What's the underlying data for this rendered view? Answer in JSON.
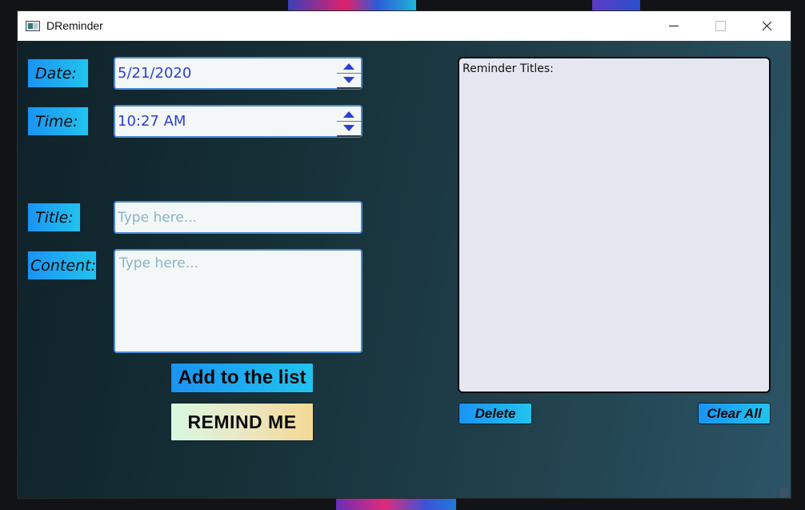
{
  "window": {
    "title": "DReminder"
  },
  "labels": {
    "date": "Date:",
    "time": "Time:",
    "title": "Title:",
    "content": "Content:"
  },
  "inputs": {
    "date_value": "5/21/2020",
    "time_value": "10:27 AM",
    "title_value": "",
    "title_placeholder": "Type here...",
    "content_value": "",
    "content_placeholder": "Type here..."
  },
  "buttons": {
    "add": "Add to the list",
    "remind": "REMIND ME",
    "delete": "Delete",
    "clear_all": "Clear All"
  },
  "reminder_list": {
    "header": "Reminder Titles:",
    "items": []
  },
  "icons": {
    "app": "app-window-icon",
    "minimize": "minimize-icon",
    "maximize": "maximize-icon",
    "close": "close-icon",
    "spin_up": "arrow-up-icon",
    "spin_down": "arrow-down-icon"
  },
  "colors": {
    "label_gradient_start": "#1b93f2",
    "label_gradient_end": "#22c3ee",
    "input_text": "#2b3fd6",
    "input_border": "#4c8ad8",
    "placeholder": "#8ab3c6",
    "list_background": "#e4e7f0",
    "remind_gradient_start": "#d8f8e0",
    "remind_gradient_end": "#f4d894"
  }
}
